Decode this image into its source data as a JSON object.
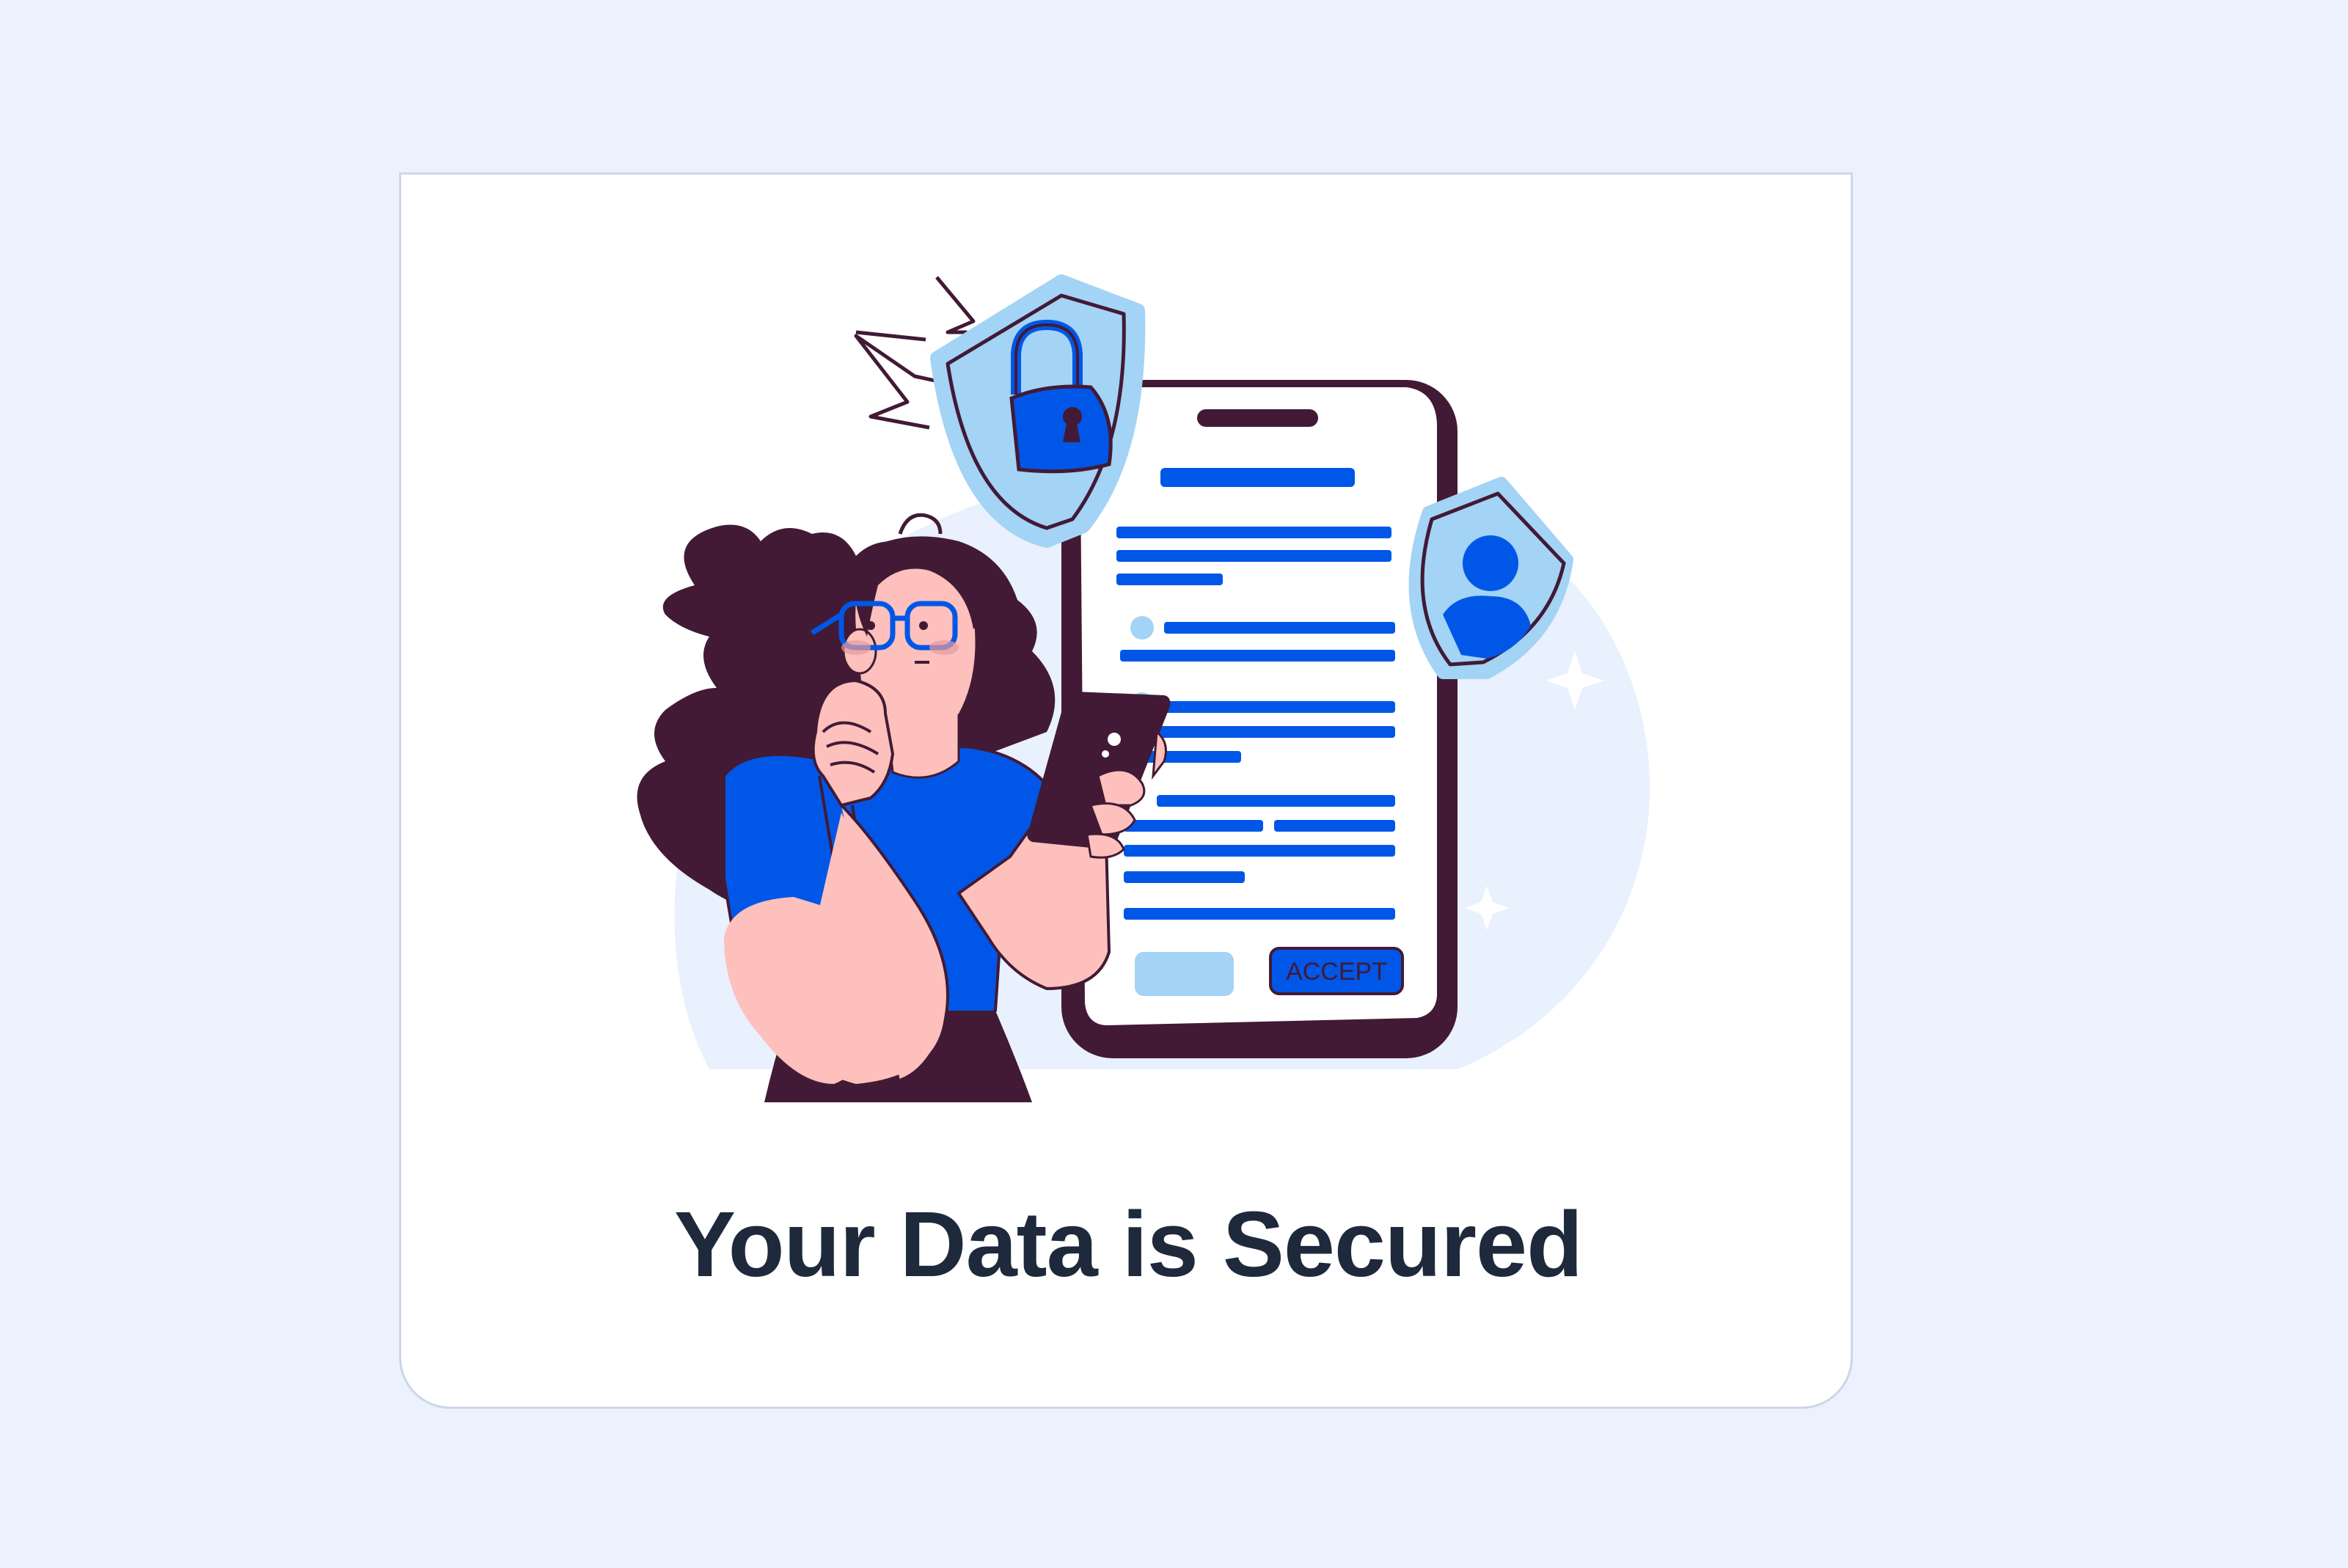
{
  "card": {
    "title": "Your Data is Secured"
  },
  "illustration": {
    "accept_button_label": "ACCEPT",
    "icons": [
      "lock-shield-icon",
      "user-shield-icon",
      "sparkle-icon",
      "lightning-icon"
    ]
  },
  "colors": {
    "page_background": "#ebf2fe",
    "card_background": "#ffffff",
    "card_border": "#cbd7e8",
    "title_text": "#1e293b",
    "accent_blue": "#0057e7",
    "light_blue": "#a3d3f5",
    "dark_plum": "#421a35",
    "skin": "#fdc0bd",
    "blob": "#e8f1fd"
  }
}
